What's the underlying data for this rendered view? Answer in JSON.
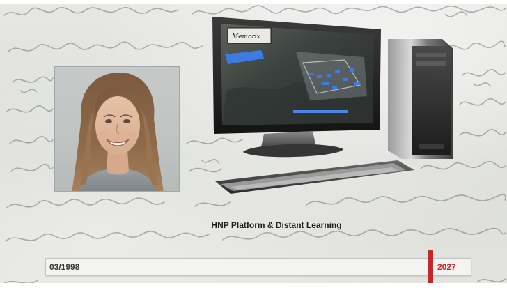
{
  "caption": {
    "text": "HNP Platform & Distant Learning"
  },
  "timeline": {
    "start_label": "03/1998",
    "end_label": "2027",
    "marker_color": "#c0282a"
  },
  "computer": {
    "screen_logo_text": "Memorix"
  },
  "icons": {
    "portrait": "portrait-photo",
    "computer": "desktop-computer-illustration",
    "letter": "handwritten-letter-background"
  }
}
